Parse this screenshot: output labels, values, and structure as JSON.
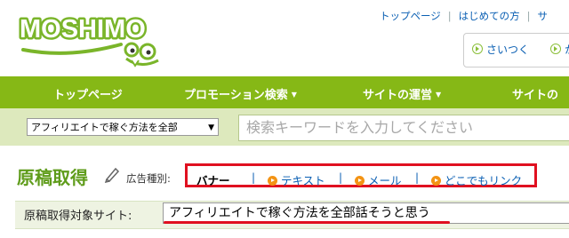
{
  "logo": {
    "text": "MOSHIMO"
  },
  "header": {
    "links": [
      "トップページ",
      "はじめての方",
      "サ"
    ],
    "sub_links": [
      "さいつく",
      "か"
    ]
  },
  "nav": {
    "items": [
      {
        "label": "トップページ",
        "dropdown": false
      },
      {
        "label": "プロモーション検索",
        "dropdown": true
      },
      {
        "label": "サイトの運営",
        "dropdown": true
      },
      {
        "label": "サイトの",
        "dropdown": false
      }
    ]
  },
  "search": {
    "select_value": "アフィリエイトで稼ぐ方法を全部",
    "placeholder": "検索キーワードを入力してください"
  },
  "page": {
    "title": "原稿取得",
    "ad_type_label": "広告種別:",
    "tabs": [
      {
        "label": "バナー",
        "active": true
      },
      {
        "label": "テキスト",
        "active": false
      },
      {
        "label": "メール",
        "active": false
      },
      {
        "label": "どこでもリンク",
        "active": false
      }
    ],
    "tab_separator": "|",
    "site_label": "原稿取得対象サイト:",
    "site_value": "アフィリエイトで稼ぐ方法を全部話そうと思う"
  },
  "colors": {
    "nav_green": "#86b816",
    "title_green": "#5f9c1b",
    "highlight_red": "#e01020",
    "orange_icon": "#f39314",
    "link_blue": "#0a5fb3"
  },
  "icons": [
    "moshimo-logo-icon",
    "play-circle-icon",
    "pencil-icon",
    "orange-play-icon"
  ]
}
